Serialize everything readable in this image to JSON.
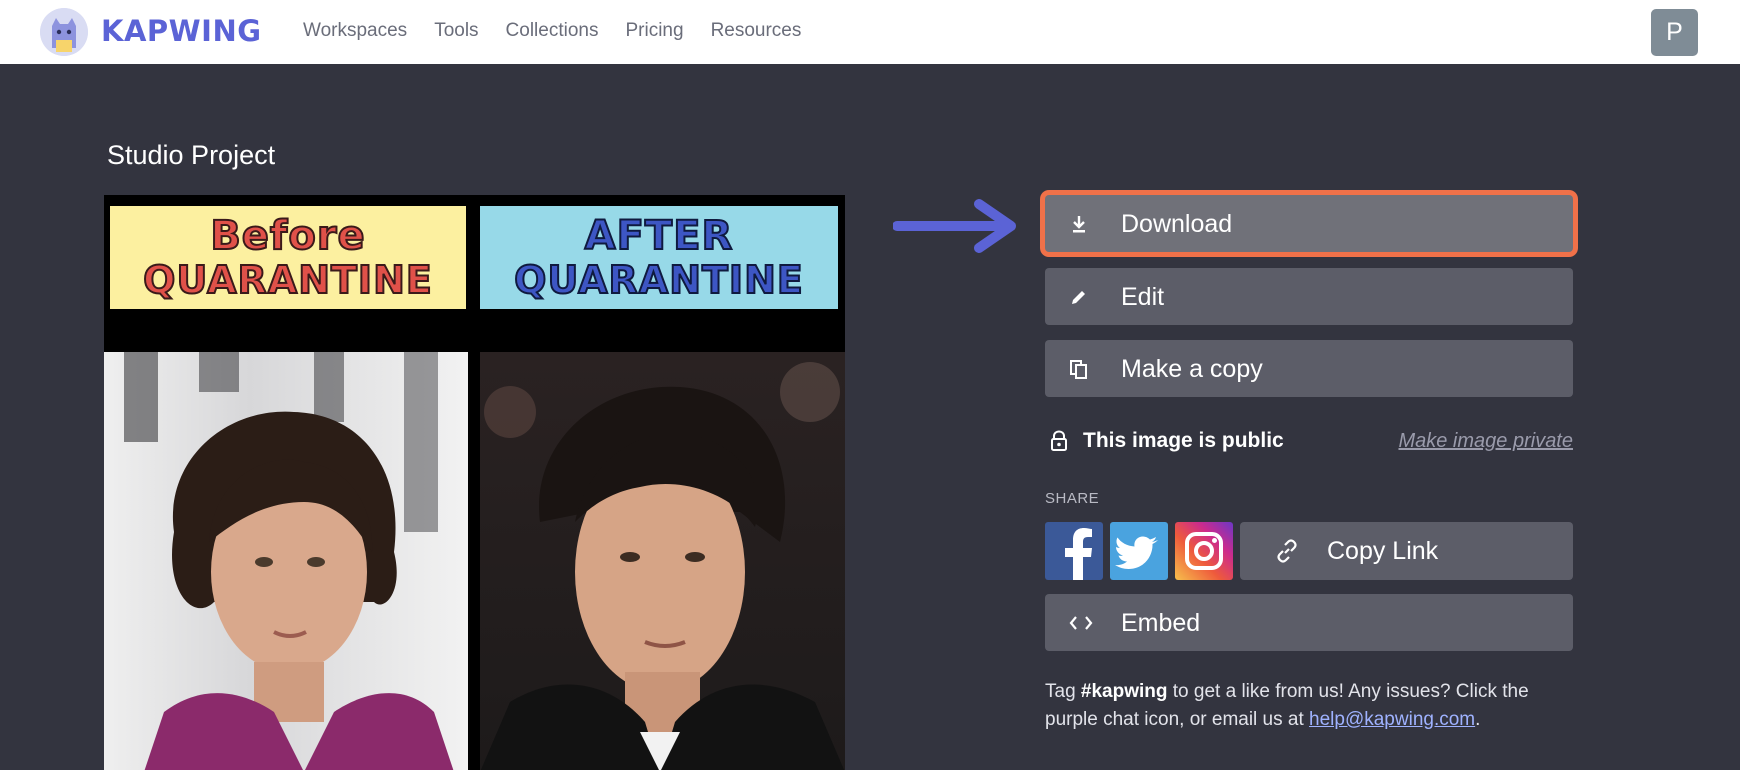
{
  "header": {
    "logo_text": "KAPWING",
    "nav": [
      "Workspaces",
      "Tools",
      "Collections",
      "Pricing",
      "Resources"
    ],
    "avatar_letter": "P"
  },
  "page": {
    "title": "Studio Project"
  },
  "meme": {
    "before": {
      "line1": "Before",
      "line2": "QUARANTINE"
    },
    "after": {
      "line1": "AFTER",
      "line2": "QUARANTINE"
    }
  },
  "actions": {
    "download": "Download",
    "edit": "Edit",
    "copy": "Make a copy",
    "public_status": "This image is public",
    "make_private": "Make image private",
    "share_label": "SHARE",
    "copy_link": "Copy Link",
    "embed": "Embed"
  },
  "footer": {
    "part1": "Tag ",
    "hashtag": "#kapwing",
    "part2": " to get a like from us! Any issues? Click the purple chat icon, or email us at ",
    "email": "help@kapwing.com",
    "part3": "."
  },
  "colors": {
    "accent": "#5b63d6",
    "highlight": "#f07149",
    "background": "#33343f",
    "button": "#5c5d68"
  },
  "icons": {
    "download": "download-icon",
    "edit": "pencil-icon",
    "copy": "copy-icon",
    "lock": "lock-icon",
    "link": "link-icon",
    "embed": "code-icon",
    "facebook": "facebook-icon",
    "twitter": "twitter-icon",
    "instagram": "instagram-icon"
  }
}
